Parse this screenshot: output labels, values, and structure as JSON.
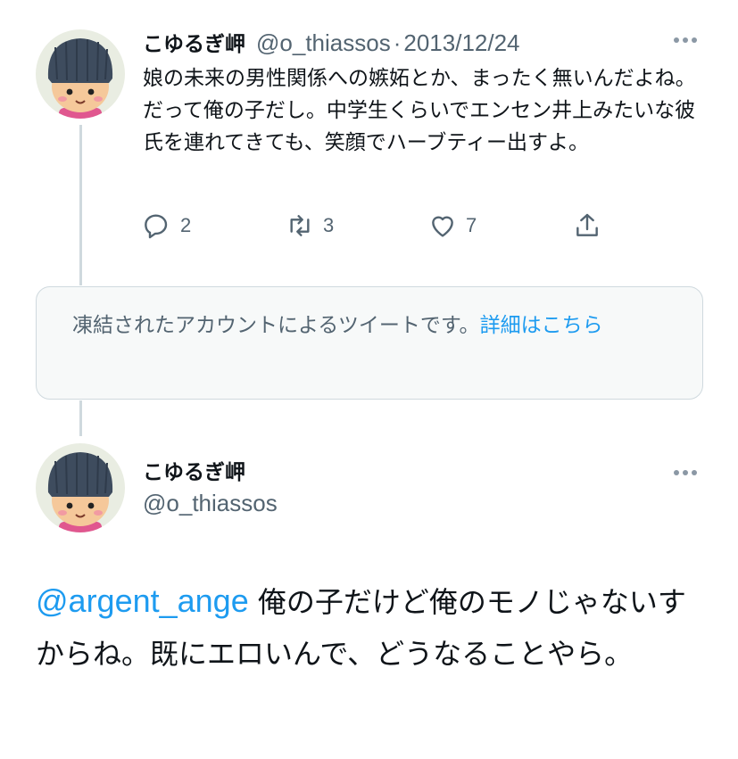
{
  "tweet1": {
    "display_name": "こゆるぎ岬",
    "handle": "@o_thiassos",
    "separator": "·",
    "date": "2013/12/24",
    "text": "娘の未来の男性関係への嫉妬とか、まったく無いんだよね。だって俺の子だし。中学生くらいでエンセン井上みたいな彼氏を連れてきても、笑顔でハーブティー出すよ。",
    "actions": {
      "reply_icon": "reply-icon",
      "reply_count": "2",
      "retweet_icon": "retweet-icon",
      "retweet_count": "3",
      "like_icon": "like-icon",
      "like_count": "7",
      "share_icon": "share-icon"
    }
  },
  "suspended_notice": {
    "text": "凍結されたアカウントによるツイートです。",
    "link": "詳細はこちら"
  },
  "tweet2": {
    "display_name": "こゆるぎ岬",
    "handle": "@o_thiassos",
    "mention": "@argent_ange",
    "text": " 俺の子だけど俺のモノじゃないすからね。既にエロいんで、どうなることやら。"
  },
  "colors": {
    "link": "#1d9bf0",
    "secondary_text": "#536471",
    "thread_line": "#cfd9de",
    "notice_bg": "#f7f9f9"
  }
}
